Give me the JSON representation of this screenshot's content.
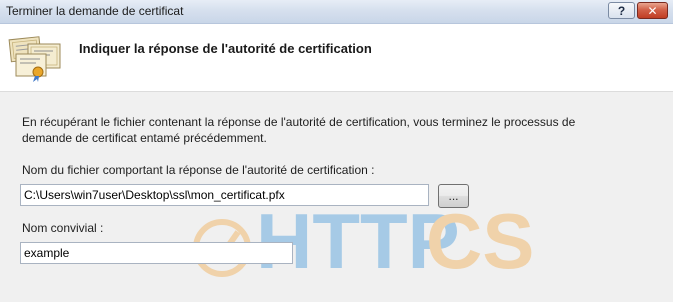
{
  "window": {
    "title": "Terminer la demande de certificat",
    "help_label": "?",
    "close_label": "✕"
  },
  "header": {
    "title": "Indiquer la réponse de l'autorité de certification",
    "icon": "certificate-icon"
  },
  "content": {
    "description": "En récupérant le fichier contenant la réponse de l'autorité de certification, vous terminez le processus de demande de certificat entamé précédemment.",
    "file_label": "Nom du fichier comportant la réponse de l'autorité de certification :",
    "file_value": "C:\\Users\\win7user\\Desktop\\ssl\\mon_certificat.pfx",
    "browse_label": "...",
    "friendly_name_label": "Nom convivial :",
    "friendly_name_value": "example"
  },
  "watermark": {
    "text_part1": "HTTP",
    "text_part2": "CS",
    "colors": {
      "blue": "#2f8fd8",
      "orange": "#f2a33a"
    }
  }
}
